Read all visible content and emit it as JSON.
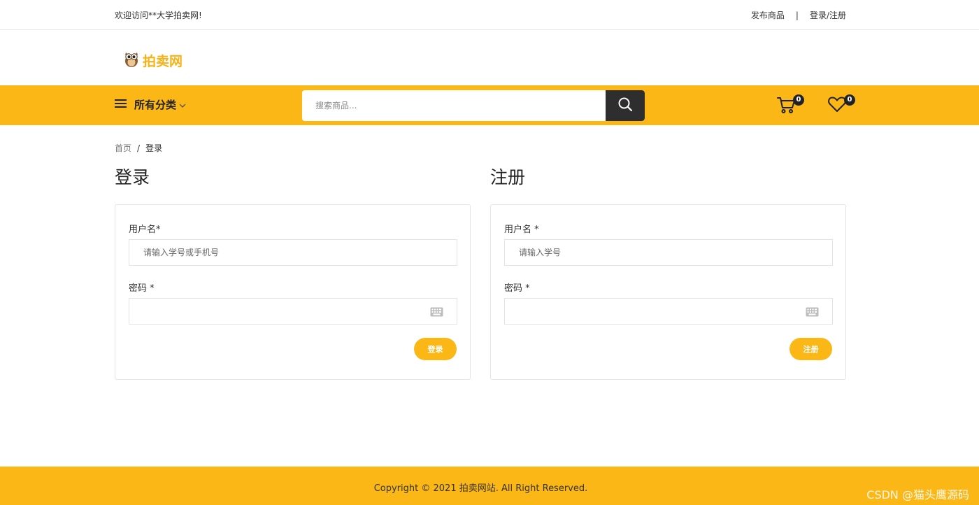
{
  "topbar": {
    "welcome": "欢迎访问**大学拍卖网!",
    "publish_link": "发布商品",
    "separator": "|",
    "login_register_link": "登录/注册"
  },
  "logo": {
    "text": "拍卖网",
    "icon": "owl-logo-icon"
  },
  "nav": {
    "category_label": "所有分类",
    "search_placeholder": "搜索商品...",
    "cart_count": "0",
    "wishlist_count": "0"
  },
  "breadcrumb": {
    "home": "首页",
    "separator": "/",
    "current": "登录"
  },
  "login": {
    "title": "登录",
    "username_label": "用户名*",
    "username_placeholder": "请输入学号或手机号",
    "password_label": "密码 *",
    "button": "登录"
  },
  "register": {
    "title": "注册",
    "username_label": "用户名 *",
    "username_placeholder": "请输入学号",
    "password_label": "密码 *",
    "button": "注册"
  },
  "footer": {
    "copyright": "Copyright © 2021 拍卖网站. All Right Reserved."
  },
  "watermark": "CSDN @猫头鹰源码",
  "colors": {
    "accent": "#fbb715",
    "dark": "#2e2e2e",
    "logo": "#f7b218"
  }
}
